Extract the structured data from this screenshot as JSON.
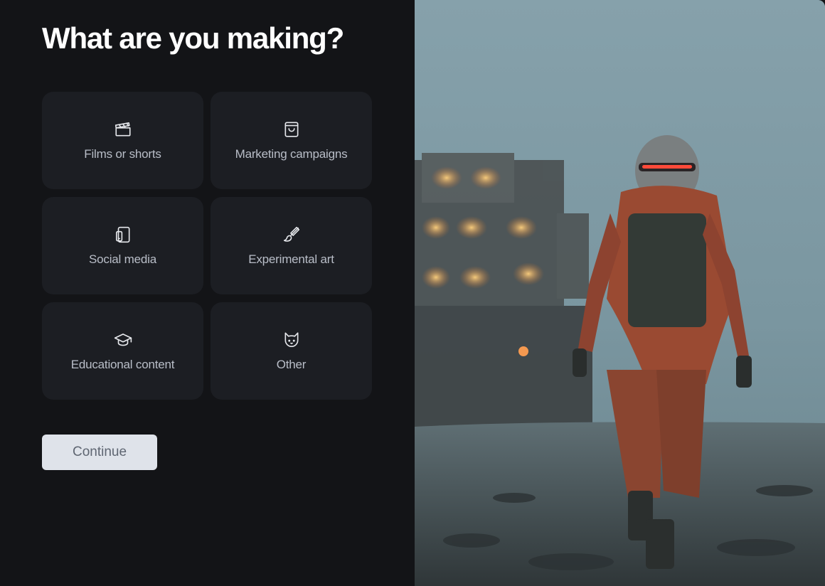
{
  "heading": "What are you making?",
  "options": [
    {
      "label": "Films or shorts",
      "icon": "clapperboard-icon"
    },
    {
      "label": "Marketing campaigns",
      "icon": "shopping-bag-icon"
    },
    {
      "label": "Social media",
      "icon": "phone-tablet-icon"
    },
    {
      "label": "Experimental art",
      "icon": "paintbrush-icon"
    },
    {
      "label": "Educational content",
      "icon": "graduation-cap-icon"
    },
    {
      "label": "Other",
      "icon": "cat-icon"
    }
  ],
  "continue_label": "Continue",
  "colors": {
    "background": "#131417",
    "card": "#1c1e23",
    "card_text": "#b9bec8",
    "button_bg": "#dfe3ea",
    "button_text": "#5f6672"
  }
}
